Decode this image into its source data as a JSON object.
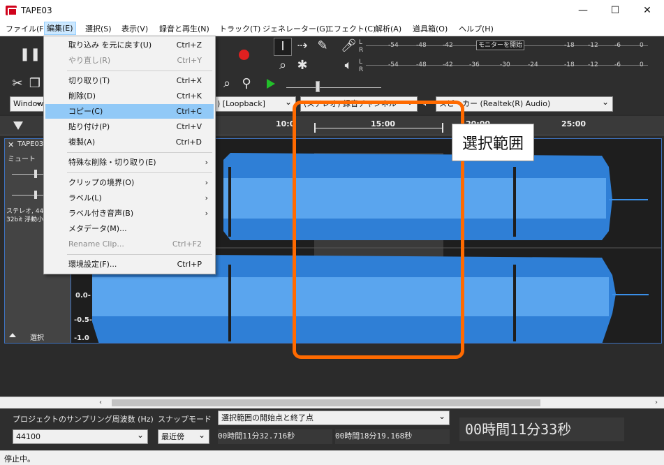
{
  "window": {
    "title": "TAPE03",
    "minimize": "—",
    "maximize": "☐",
    "close": "✕"
  },
  "menubar": [
    "ファイル(F)",
    "編集(E)",
    "選択(S)",
    "表示(V)",
    "録音と再生(N)",
    "トラック(T)",
    "ジェネレーター(G)",
    "エフェクト(C)",
    "解析(A)",
    "道具箱(O)",
    "ヘルプ(H)"
  ],
  "edit_menu": {
    "undo": "取り込み を元に戻す(U)",
    "undo_sc": "Ctrl+Z",
    "redo": "やり直し(R)",
    "redo_sc": "Ctrl+Y",
    "cut": "切り取り(T)",
    "cut_sc": "Ctrl+X",
    "delete": "削除(D)",
    "delete_sc": "Ctrl+K",
    "copy": "コピー(C)",
    "copy_sc": "Ctrl+C",
    "paste": "貼り付け(P)",
    "paste_sc": "Ctrl+V",
    "duplicate": "複製(A)",
    "duplicate_sc": "Ctrl+D",
    "special": "特殊な削除・切り取り(E)",
    "clip_boundary": "クリップの境界(O)",
    "labels": "ラベル(L)",
    "labeled_audio": "ラベル付き音声(B)",
    "metadata": "メタデータ(M)...",
    "rename_clip": "Rename Clip...",
    "rename_clip_sc": "Ctrl+F2",
    "preferences": "環境設定(F)...",
    "preferences_sc": "Ctrl+P"
  },
  "meters": {
    "record_ticks": [
      "-54",
      "-48",
      "-42",
      "-18",
      "-12",
      "-6",
      "0"
    ],
    "monitor_button": "モニターを開始",
    "play_ticks": [
      "-54",
      "-48",
      "-42",
      "-36",
      "-30",
      "-24",
      "-18",
      "-12",
      "-6",
      "0"
    ],
    "lr": [
      "L",
      "R"
    ]
  },
  "devices": {
    "host": "Window",
    "input": ") [Loopback]",
    "channels": "(ステレオ) 録音チャンネル",
    "output": "スピーカー (Realtek(R) Audio)"
  },
  "ruler": {
    "labels": [
      "10:0",
      "15:00",
      "20:00",
      "25:00"
    ]
  },
  "track": {
    "name": "TAPE03",
    "mute": "ミュート",
    "info1": "ステレオ, 44",
    "info2": "32bit 浮動小",
    "select": "選択",
    "scale": [
      "0.0-",
      "-0.5-",
      "-1.0"
    ]
  },
  "callout": "選択範囲",
  "bottom": {
    "rate_label": "プロジェクトのサンプリング周波数 (Hz)",
    "rate_value": "44100",
    "snap_label": "スナップモード",
    "snap_value": "最近傍",
    "sel_mode": "選択範囲の開始点と終了点",
    "sel_start": "00時間11分32.716秒",
    "sel_end": "00時間18分19.168秒",
    "position": "00時間11分33秒",
    "status": "停止中。"
  }
}
